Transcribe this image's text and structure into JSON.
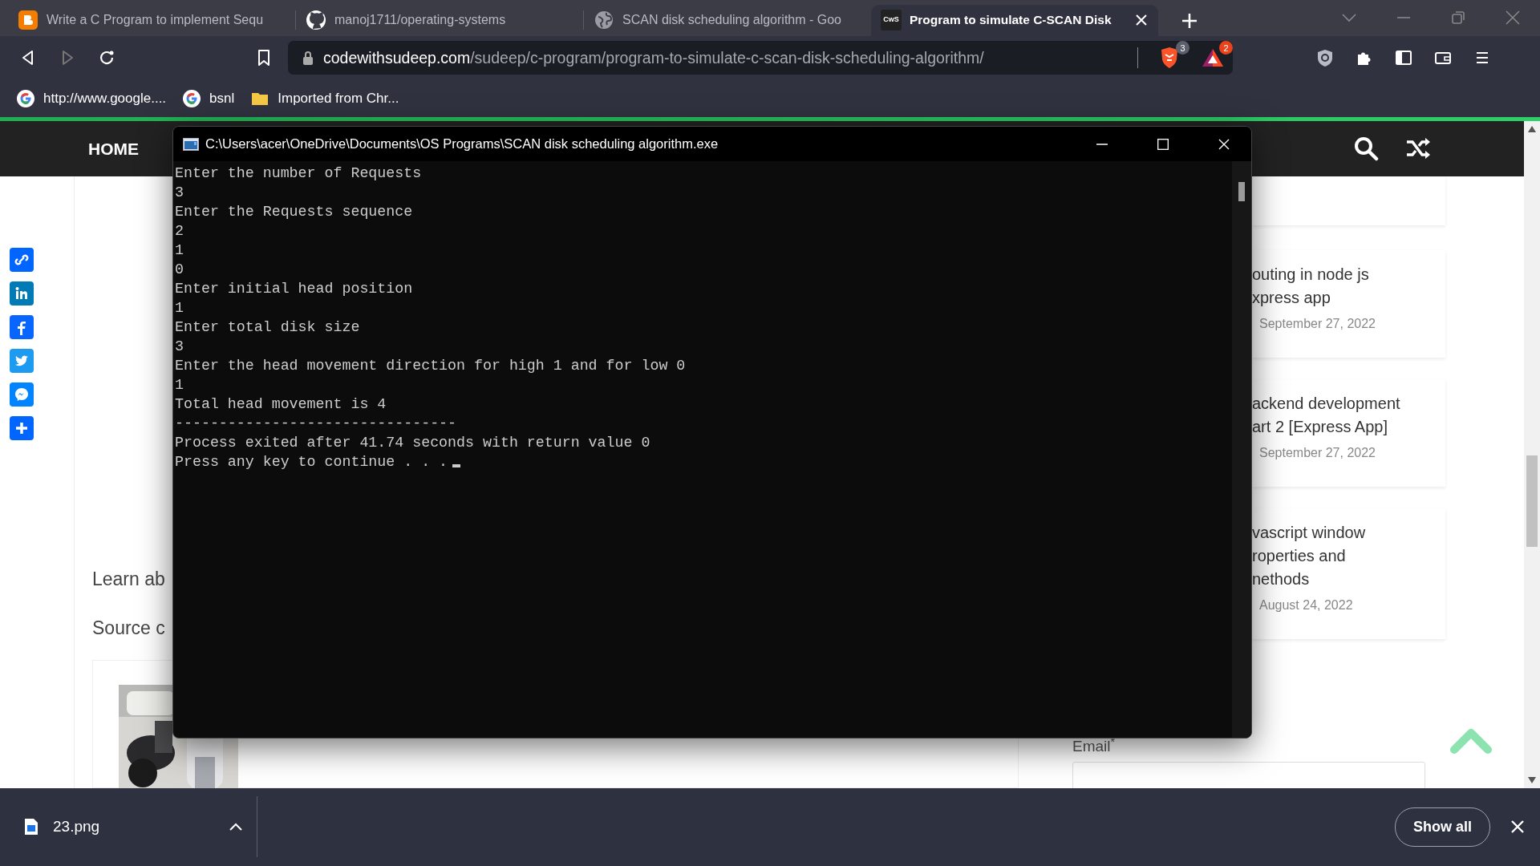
{
  "browser": {
    "tabs": [
      {
        "title": "Write a C Program to implement Sequ",
        "selected": false
      },
      {
        "title": "manoj1711/operating-systems",
        "selected": false
      },
      {
        "title": "SCAN disk scheduling algorithm - Goo",
        "selected": false
      },
      {
        "title": "Program to simulate C-SCAN Disk",
        "selected": true,
        "favicon_text": "CwS"
      }
    ],
    "address": {
      "host": "codewithsudeep.com",
      "path": "/sudeep/c-program/program-to-simulate-c-scan-disk-scheduling-algorithm/"
    },
    "shield_badge": "3",
    "rewards_badge": "2",
    "bookmarks": [
      {
        "label": "http://www.google...."
      },
      {
        "label": "bsnl"
      },
      {
        "label": "Imported from Chr..."
      }
    ]
  },
  "site": {
    "nav_items": [
      "HOME"
    ],
    "content_lines": [
      "Learn ab",
      "Source c"
    ],
    "sidebar_posts": [
      {
        "title_lines": [
          "outing in node js",
          "xpress app"
        ],
        "date": "September 27, 2022"
      },
      {
        "title_lines": [
          "ackend development",
          "art 2 [Express App]"
        ],
        "date": "September 27, 2022"
      },
      {
        "title_lines": [
          "vascript window",
          "roperties and",
          "nethods"
        ],
        "date": "August 24, 2022"
      }
    ],
    "email_label": "Email$^{*}$"
  },
  "console": {
    "title": "C:\\Users\\acer\\OneDrive\\Documents\\OS Programs\\SCAN disk scheduling algorithm.exe",
    "lines": [
      "Enter the number of Requests",
      "3",
      "Enter the Requests sequence",
      "2",
      "1",
      "0",
      "Enter initial head position",
      "1",
      "Enter total disk size",
      "3",
      "Enter the head movement direction for high 1 and for low 0",
      "1",
      "Total head movement is 4",
      "--------------------------------",
      "Process exited after 41.74 seconds with return value 0",
      "Press any key to continue . . ."
    ]
  },
  "downloads": {
    "file": "23.png",
    "show_all": "Show all"
  }
}
